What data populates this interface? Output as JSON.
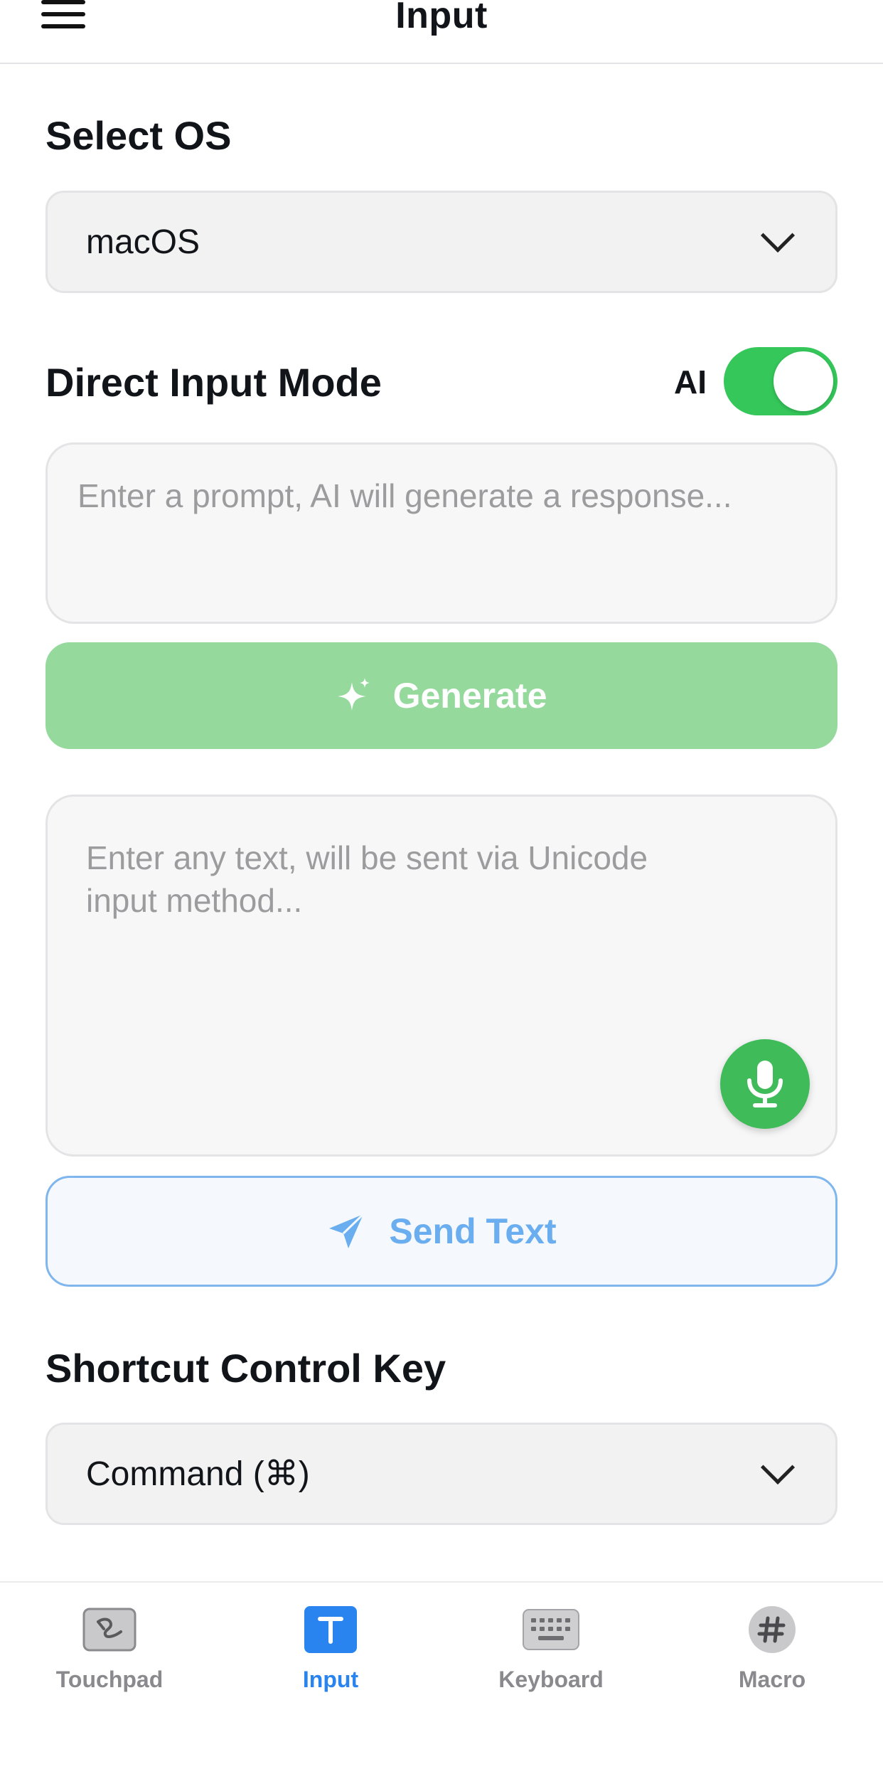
{
  "header": {
    "title": "Input"
  },
  "os": {
    "title": "Select OS",
    "selected": "macOS"
  },
  "direct_input": {
    "title": "Direct Input Mode",
    "ai_label": "AI",
    "ai_enabled": true
  },
  "prompt": {
    "placeholder": "Enter a prompt, AI will generate a response..."
  },
  "generate": {
    "label": "Generate"
  },
  "text_input": {
    "placeholder_line1": "Enter any text, will be sent via Unicode",
    "placeholder_line2": "input method..."
  },
  "send": {
    "label": "Send Text"
  },
  "shortcut": {
    "title": "Shortcut Control Key",
    "selected": "Command (⌘)"
  },
  "tabs": [
    {
      "label": "Touchpad",
      "icon": "touchpad-icon",
      "active": false
    },
    {
      "label": "Input",
      "icon": "text-input-icon",
      "active": true
    },
    {
      "label": "Keyboard",
      "icon": "keyboard-icon",
      "active": false
    },
    {
      "label": "Macro",
      "icon": "hash-icon",
      "active": false
    }
  ],
  "colors": {
    "accent_green": "#35c75a",
    "generate_disabled": "#95d99c",
    "accent_blue": "#2a84f0",
    "send_text": "#6aaef0"
  }
}
